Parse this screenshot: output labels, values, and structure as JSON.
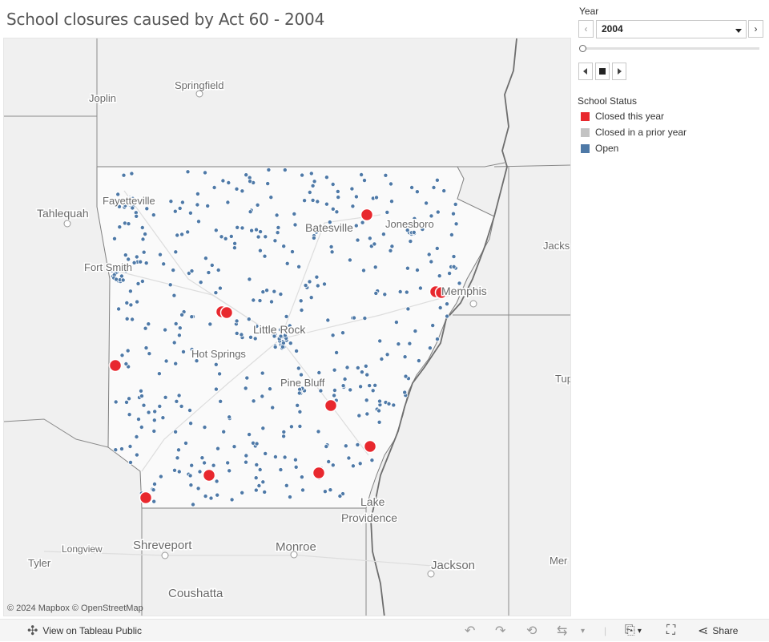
{
  "title": "School closures caused by Act 60 - 2004",
  "map": {
    "attribution": "© 2024 Mapbox  © OpenStreetMap",
    "colors": {
      "closed_this_year": "#e8282e",
      "closed_prior": "#c3c3c3",
      "open": "#4e79a7",
      "land": "#f2f2f2",
      "state": "#fbfbfb",
      "border": "#8a8a8a",
      "river": "#7a7a7a"
    },
    "place_labels": {
      "springfield": "Springfield",
      "joplin": "Joplin",
      "tahlequah": "Tahlequah",
      "fayetteville": "Fayetteville",
      "batesville": "Batesville",
      "jonesboro": "Jonesboro",
      "jackson_tn": "Jacks",
      "fort_smith": "Fort Smith",
      "memphis": "Memphis",
      "little_rock": "Little Rock",
      "hot_springs": "Hot Springs",
      "tupelo": "Tup",
      "pine_bluff": "Pine Bluff",
      "lake_providence_1": "Lake",
      "lake_providence_2": "Providence",
      "longview": "Longview",
      "shreveport": "Shreveport",
      "monroe": "Monroe",
      "tyler": "Tyler",
      "jackson_ms": "Jackson",
      "meridian": "Mer",
      "coushatta": "Coushatta"
    }
  },
  "controls": {
    "year_label": "Year",
    "year_value": "2004",
    "prev_icon": "chevron-left-icon",
    "next_icon": "chevron-right-icon",
    "play_icons": [
      "step-back-icon",
      "stop-icon",
      "step-forward-icon"
    ]
  },
  "legend": {
    "title": "School Status",
    "items": [
      {
        "label": "Closed this year",
        "color": "#e8282e"
      },
      {
        "label": "Closed in a prior year",
        "color": "#c3c3c3"
      },
      {
        "label": "Open",
        "color": "#4e79a7"
      }
    ]
  },
  "toolbar": {
    "view_label": "View on Tableau Public",
    "share_label": "Share"
  }
}
